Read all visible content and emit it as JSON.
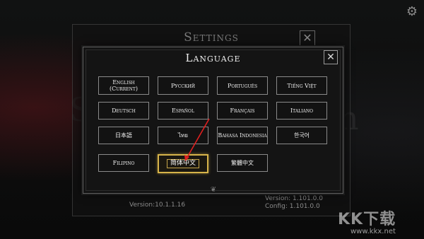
{
  "settings": {
    "title": "Settings",
    "version_left": "Version:10.1.1.16",
    "version_right": "Version: 1.101.0.0",
    "config": "Config: 1.101.0.0"
  },
  "dialog": {
    "title": "Language",
    "close_symbol": "✕"
  },
  "languages": [
    {
      "label": "English (Current)"
    },
    {
      "label": "Русский"
    },
    {
      "label": "Português"
    },
    {
      "label": "Tiếng Việt"
    },
    {
      "label": "Deutsch"
    },
    {
      "label": "Español"
    },
    {
      "label": "Français"
    },
    {
      "label": "Italiano"
    },
    {
      "label": "日本語"
    },
    {
      "label": "ไทย"
    },
    {
      "label": "Bahasa Indonesia"
    },
    {
      "label": "한국어"
    },
    {
      "label": "Filipino"
    },
    {
      "label": "简体中文"
    },
    {
      "label": "繁體中文"
    }
  ],
  "watermark": {
    "main": "KK下载",
    "url": "www.kkx.net"
  },
  "colors": {
    "selected_border": "#d6b34a",
    "arrow": "#e02020"
  },
  "icons": {
    "gear": "gear-icon",
    "close": "close-icon"
  }
}
